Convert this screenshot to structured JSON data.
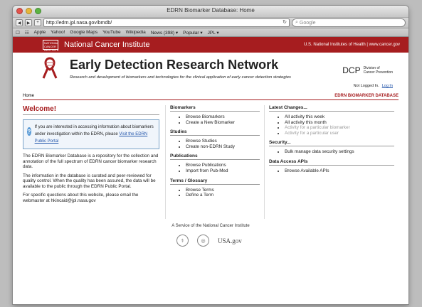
{
  "window": {
    "title": "EDRN Biomarker Database: Home"
  },
  "browser": {
    "url": "http://edrn.jpl.nasa.gov/bmdb/",
    "search_placeholder": "Google",
    "bookmarks": [
      "Apple",
      "Yahoo!",
      "Google Maps",
      "YouTube",
      "Wikipedia",
      "News (398) ▾",
      "Popular ▾",
      "JPL ▾"
    ]
  },
  "nci": {
    "title": "National Cancer Institute",
    "right": "U.S. National Institutes of Health | www.cancer.gov",
    "logo": "NATIONAL CANCER INSTITUTE"
  },
  "header": {
    "title": "Early Detection Research Network",
    "subtitle": "Research and development of biomarkers and technologies for the clinical application of early cancer detection strategies",
    "dcp": "DCP",
    "dcp_sub1": "Division of",
    "dcp_sub2": "Cancer Prevention",
    "login_status": "Not Logged In.",
    "login_link": "Log In"
  },
  "nav": {
    "home": "Home",
    "db": "EDRN BIOMARKER DATABASE"
  },
  "welcome": {
    "title": "Welcome!",
    "info_prefix": "If you are interested in accessing information about biomarkers under investigation within the EDRN, please",
    "info_link": "Visit the EDRN Public Portal",
    "para1": "The EDRN Biomarker Database is a repository for the collection and annotation of the full spectrum of EDRN cancer biomarker research data.",
    "para2": "The information in the database is curated and peer-reviewed for quality control. When the quality has been assured, the data will be available to the public through the EDRN Public Portal.",
    "para3": "For specific questions about this website, please email the webmaster at hkincaid@jpl.nasa.gov"
  },
  "middle": {
    "biomarkers_head": "Biomarkers",
    "biomarkers": [
      "Browse Biomarkers",
      "Create a New Biomarker"
    ],
    "studies_head": "Studies",
    "studies": [
      "Browse Studies",
      "Create non-EDRN Study"
    ],
    "publications_head": "Publications",
    "publications": [
      "Browse Publications",
      "Import from Pub-Med"
    ],
    "terms_head": "Terms / Glossary",
    "terms": [
      "Browse Terms",
      "Define a Term"
    ]
  },
  "right": {
    "changes_head": "Latest Changes...",
    "changes": [
      "All activity this week",
      "All activity this month",
      "Activity for a particular biomarker",
      "Activity for a particular user"
    ],
    "security_head": "Security...",
    "security": [
      "Bulk manage data security settings"
    ],
    "api_head": "Data Access APIs",
    "api": [
      "Browse Available APIs"
    ]
  },
  "footer": {
    "text": "A Service of the National Cancer Institute",
    "usagov": "USA.gov"
  }
}
